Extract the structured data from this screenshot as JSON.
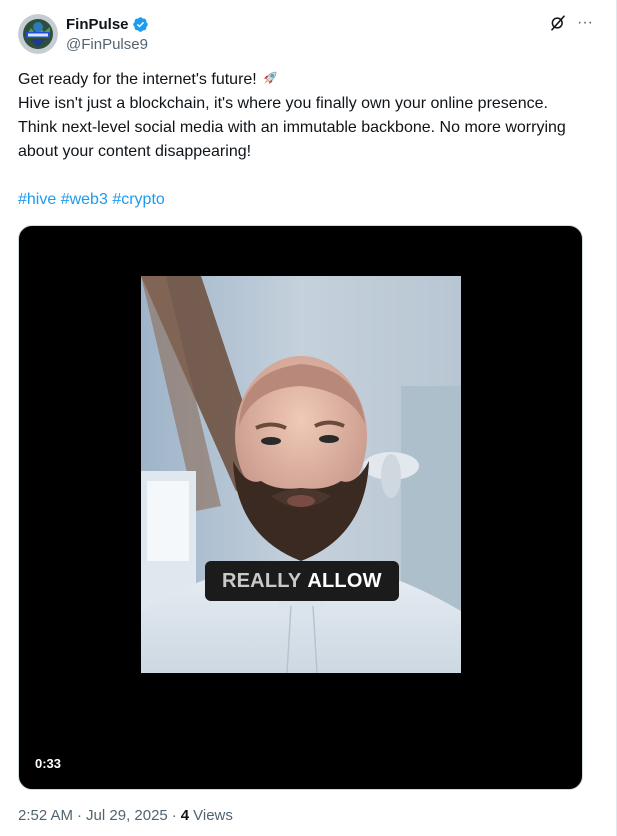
{
  "author": {
    "display_name": "FinPulse",
    "handle": "@FinPulse9",
    "verified": true,
    "avatar_icon": "finpulse-logo-avatar",
    "verified_color": "#1d9bf0"
  },
  "actions": {
    "grok_icon": "grok-icon",
    "more_label": "···"
  },
  "tweet": {
    "line1": "Get ready for the internet's future!",
    "line1_emoji": "rocket-emoji",
    "line2": "Hive isn't just a blockchain, it's where you finally own your online presence. Think next-level social media with an immutable backbone. No more worrying about your content disappearing!",
    "hashtags": [
      "#hive",
      "#web3",
      "#crypto"
    ],
    "hashtag_color": "#1d9bf0"
  },
  "video": {
    "caption_word1": "REALLY",
    "caption_word2": "ALLOW",
    "duration": "0:33"
  },
  "meta": {
    "time": "2:52 AM",
    "separator": "·",
    "date": "Jul 29, 2025",
    "views_count": "4",
    "views_label": "Views"
  }
}
